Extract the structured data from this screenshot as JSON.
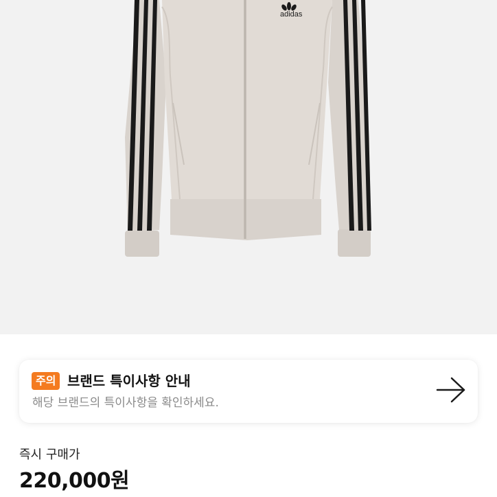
{
  "product": {
    "image_alt": "adidas track jacket",
    "logo_text": "adidas"
  },
  "notice": {
    "badge": "주의",
    "title": "브랜드 특이사항 안내",
    "subtitle": "해당 브랜드의 특이사항을 확인하세요.",
    "arrow_icon": "arrow-right-icon"
  },
  "price": {
    "label": "즉시 구매가",
    "value": "220,000원"
  },
  "colors": {
    "badge": "#f47b20",
    "jacket": "#ddd7d2",
    "stripes": "#1a1a1a"
  }
}
